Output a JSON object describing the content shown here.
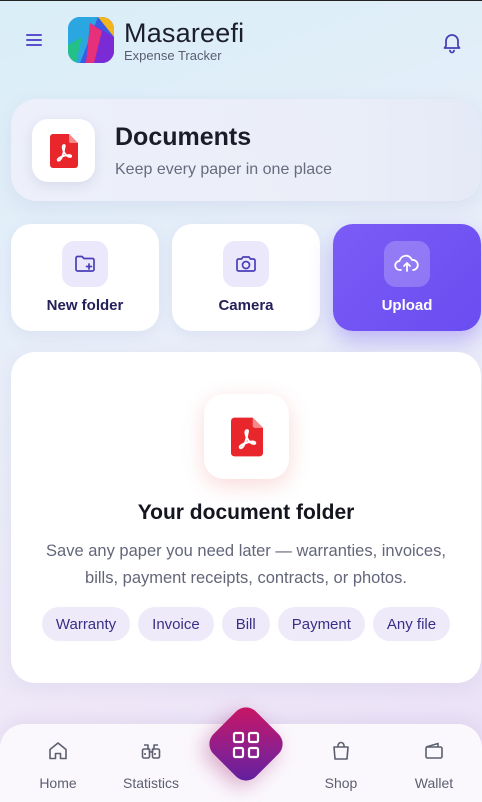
{
  "app": {
    "title": "Masareefi",
    "subtitle": "Expense Tracker"
  },
  "hero": {
    "title": "Documents",
    "subtitle": "Keep every paper in one place"
  },
  "actions": [
    {
      "label": "New folder",
      "icon": "folder-plus-icon"
    },
    {
      "label": "Camera",
      "icon": "camera-icon"
    },
    {
      "label": "Upload",
      "icon": "cloud-upload-icon"
    }
  ],
  "folder": {
    "title": "Your document folder",
    "description": "Save any paper you need later — warranties, invoices, bills, payment receipts, contracts, or photos.",
    "chips": [
      "Warranty",
      "Invoice",
      "Bill",
      "Payment",
      "Any file"
    ]
  },
  "nav": [
    {
      "label": "Home",
      "icon": "home-icon"
    },
    {
      "label": "Statistics",
      "icon": "binoculars-icon"
    },
    {
      "label": "Shop",
      "icon": "shopping-bag-icon"
    },
    {
      "label": "Wallet",
      "icon": "wallet-icon"
    }
  ],
  "colors": {
    "accent": "#6a4cf1",
    "pdf_red": "#e8262b",
    "chip_bg": "#eeeafa",
    "fab_start": "#d0155f",
    "fab_end": "#5a1fa0"
  }
}
